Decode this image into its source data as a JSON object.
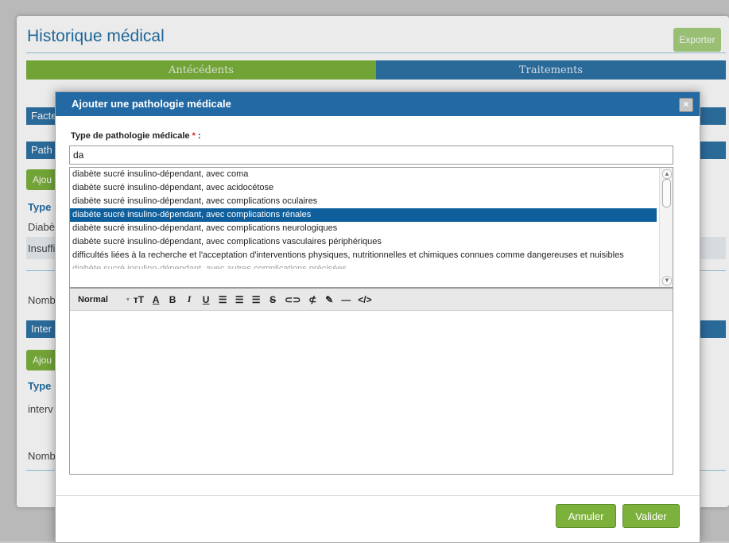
{
  "page": {
    "title": "Historique médical",
    "export_label": "Exporter",
    "tabs": [
      {
        "label": "Antécédents"
      },
      {
        "label": "Traitements"
      }
    ],
    "sections": {
      "facteurs": "Facte",
      "pathologies": "Path",
      "interventions": "Inter"
    },
    "add_label": "Ajou",
    "type_label": "Type",
    "rows": {
      "diabete": "Diabè",
      "insuffisance": "Insuffi",
      "intervention": "interv"
    },
    "nombre_label": "Nomb"
  },
  "modal": {
    "title": "Ajouter une pathologie médicale",
    "close_icon": "×",
    "field_label": "Type de pathologie médicale",
    "required_mark": "*",
    "field_suffix": " :",
    "search_value": "da",
    "suggestions": [
      "diabète sucré insulino-dépendant, avec coma",
      "diabète sucré insulino-dépendant, avec acidocétose",
      "diabète sucré insulino-dépendant, avec complications oculaires",
      "diabète sucré insulino-dépendant, avec complications rénales",
      "diabète sucré insulino-dépendant, avec complications neurologiques",
      "diabète sucré insulino-dépendant, avec complications vasculaires périphériques",
      "difficultés liées à la recherche et l'acceptation d'interventions physiques, nutritionnelles et chimiques connues comme dangereuses et nuisibles",
      "diabète sucré insulino-dépendant, avec autres complications précisées"
    ],
    "selected_index": 3,
    "toolbar": {
      "format": "Normal",
      "caret": "▾",
      "font_size": "тT",
      "font_color": "A",
      "bold": "B",
      "italic": "I",
      "underline": "U",
      "align_left": "☰",
      "align_center": "☰",
      "align_right": "☰",
      "strike": "S",
      "link": "⊂⊃",
      "unlink": "⊄",
      "clear": "✎",
      "hr": "—",
      "source": "</>"
    },
    "cancel_label": "Annuler",
    "submit_label": "Valider"
  },
  "colors": {
    "primary_blue": "#2369a3",
    "accent_green": "#7cb13c",
    "selected_row": "#0f5f9c"
  }
}
